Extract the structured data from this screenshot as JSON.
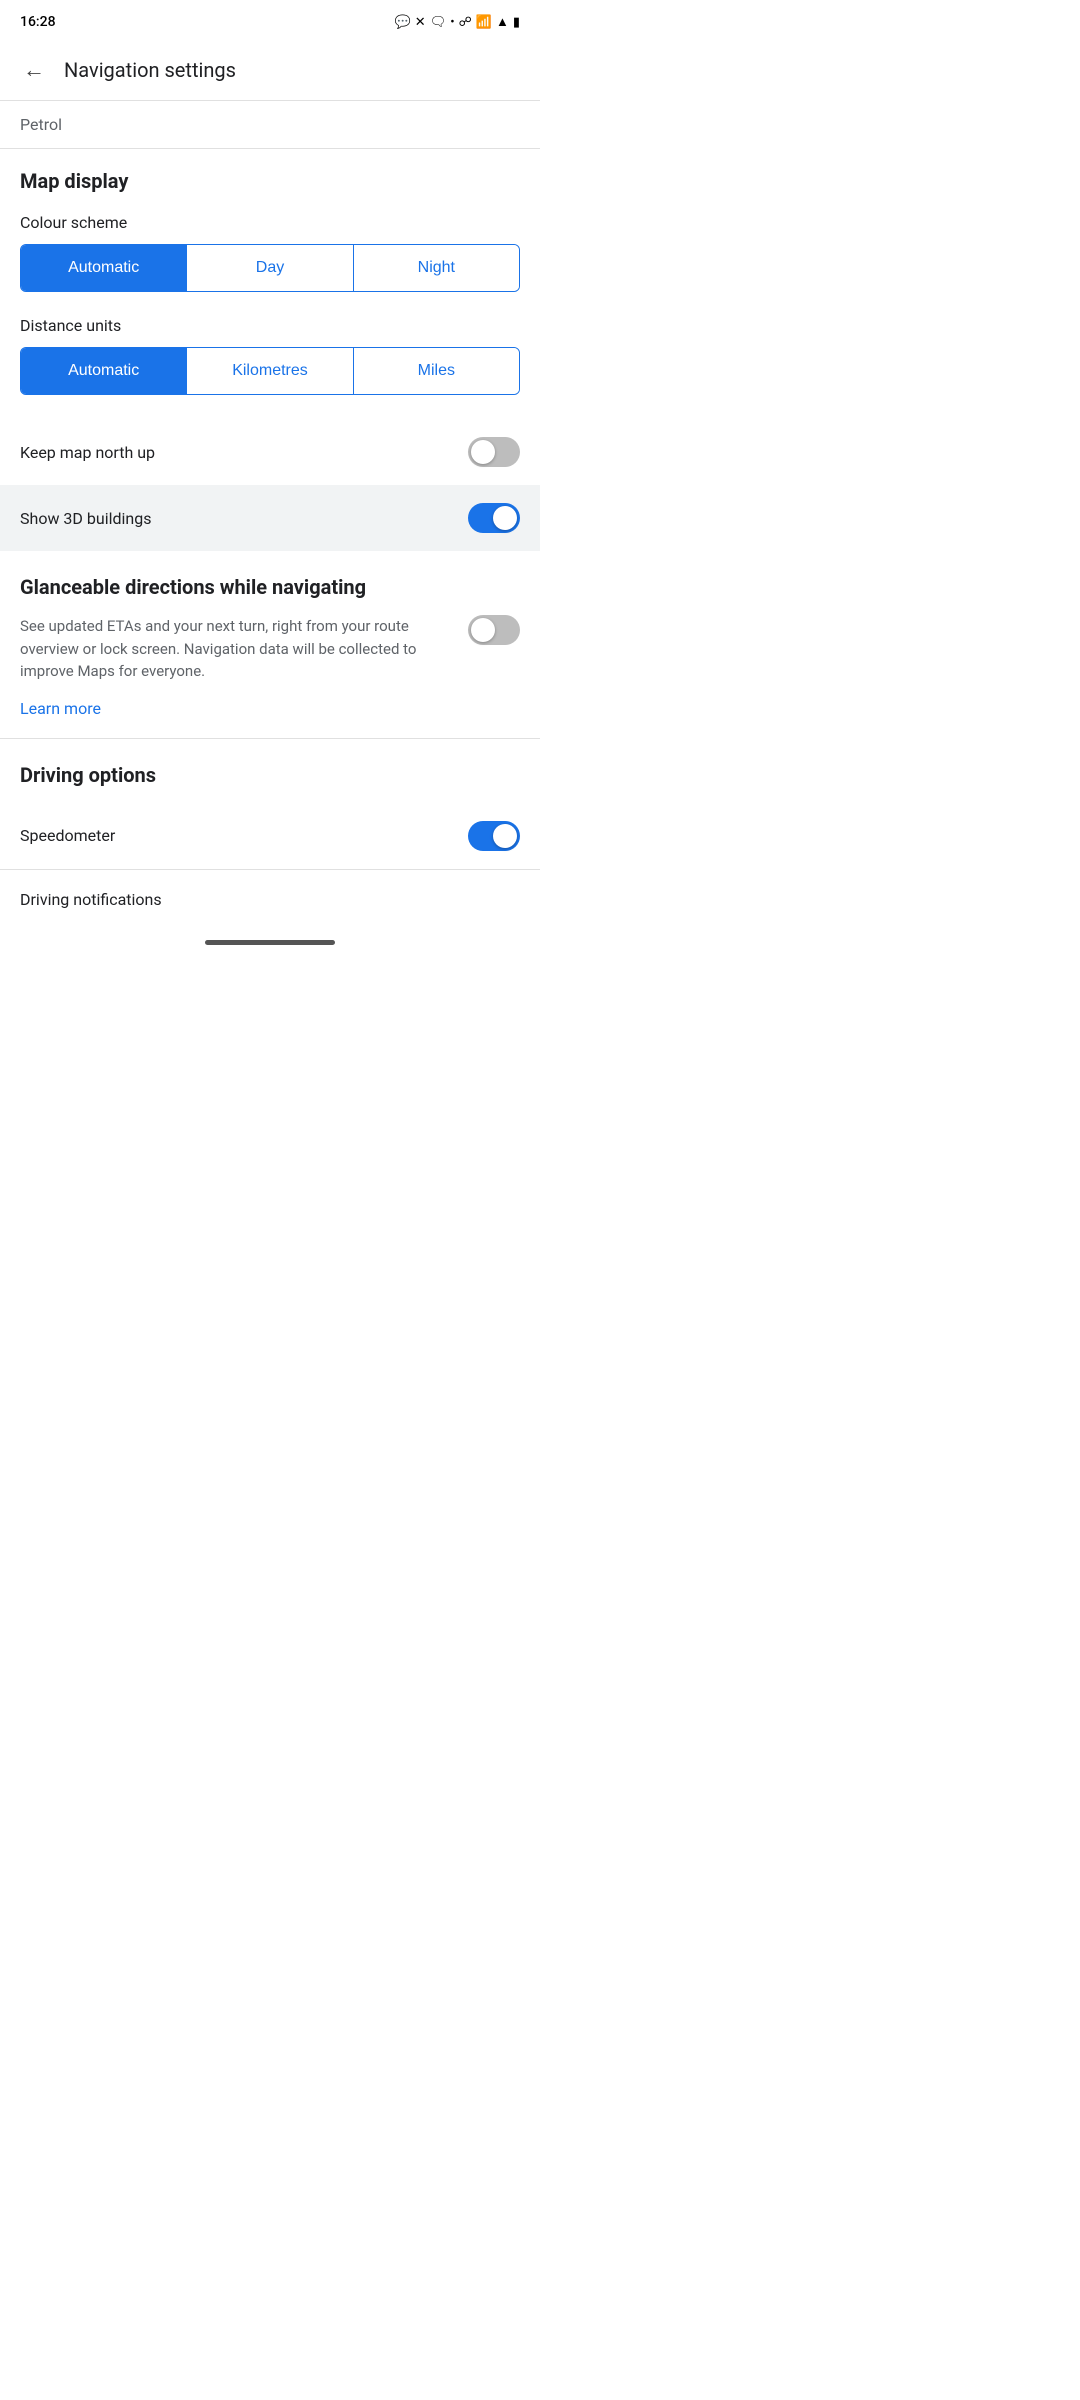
{
  "statusBar": {
    "time": "16:28",
    "icons": [
      "whatsapp",
      "x",
      "chat",
      "dot",
      "location",
      "wifi",
      "signal",
      "battery"
    ]
  },
  "header": {
    "backLabel": "←",
    "title": "Navigation settings"
  },
  "petrol": {
    "label": "Petrol"
  },
  "mapDisplay": {
    "sectionTitle": "Map display",
    "colourSchemeLabel": "Colour scheme",
    "colourSchemeOptions": [
      "Automatic",
      "Day",
      "Night"
    ],
    "colourSchemeSelected": "Automatic",
    "distanceUnitsLabel": "Distance units",
    "distanceUnitsOptions": [
      "Automatic",
      "Kilometres",
      "Miles"
    ],
    "distanceUnitsSelected": "Automatic",
    "keepNorthUpLabel": "Keep map north up",
    "keepNorthUpEnabled": false,
    "show3DBuildingsLabel": "Show 3D buildings",
    "show3DBuildingsEnabled": true
  },
  "glanceable": {
    "title": "Glanceable directions while navigating",
    "description": "See updated ETAs and your next turn, right from your route overview or lock screen. Navigation data will be collected to improve Maps for everyone.",
    "enabled": false,
    "learnMoreLabel": "Learn more"
  },
  "drivingOptions": {
    "sectionTitle": "Driving options",
    "speedometerLabel": "Speedometer",
    "speedometerEnabled": true,
    "drivingNotificationsLabel": "Driving notifications"
  }
}
